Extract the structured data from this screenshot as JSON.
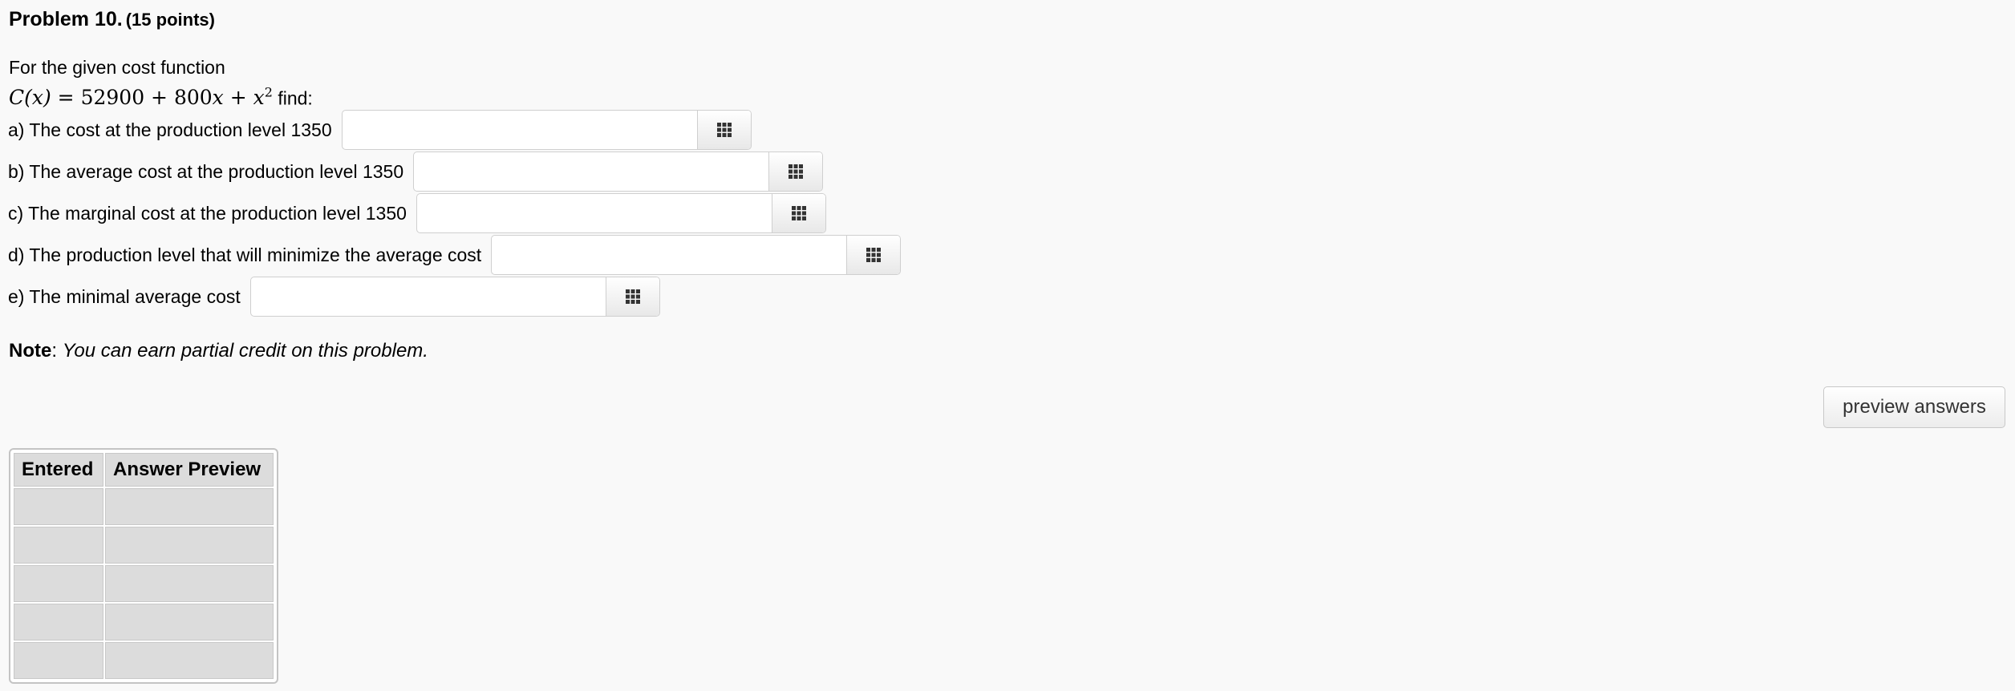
{
  "problem": {
    "title": "Problem 10.",
    "points": "(15 points)"
  },
  "intro": {
    "lead": "For the given cost function",
    "formula": {
      "lhs": "C(x) = ",
      "constant": "52900",
      "linear_coef": "800",
      "var": "x",
      "exponent": "2",
      "suffix": "find:"
    }
  },
  "questions": [
    {
      "label": "a) The cost at the production level 1350",
      "value": "",
      "palette_icon": "keypad-grid-icon"
    },
    {
      "label": "b) The average cost at the production level 1350",
      "value": "",
      "palette_icon": "keypad-grid-icon"
    },
    {
      "label": "c) The marginal cost at the production level 1350",
      "value": "",
      "palette_icon": "keypad-grid-icon"
    },
    {
      "label": "d) The production level that will minimize the average cost",
      "value": "",
      "palette_icon": "keypad-grid-icon"
    },
    {
      "label": "e) The minimal average cost",
      "value": "",
      "palette_icon": "keypad-grid-icon"
    }
  ],
  "note": {
    "label": "Note",
    "text": "You can earn partial credit on this problem."
  },
  "preview_button": "preview answers",
  "answer_table": {
    "headers": [
      "Entered",
      "Answer Preview"
    ],
    "rows": [
      [
        "",
        ""
      ],
      [
        "",
        ""
      ],
      [
        "",
        ""
      ],
      [
        "",
        ""
      ],
      [
        "",
        ""
      ]
    ]
  }
}
